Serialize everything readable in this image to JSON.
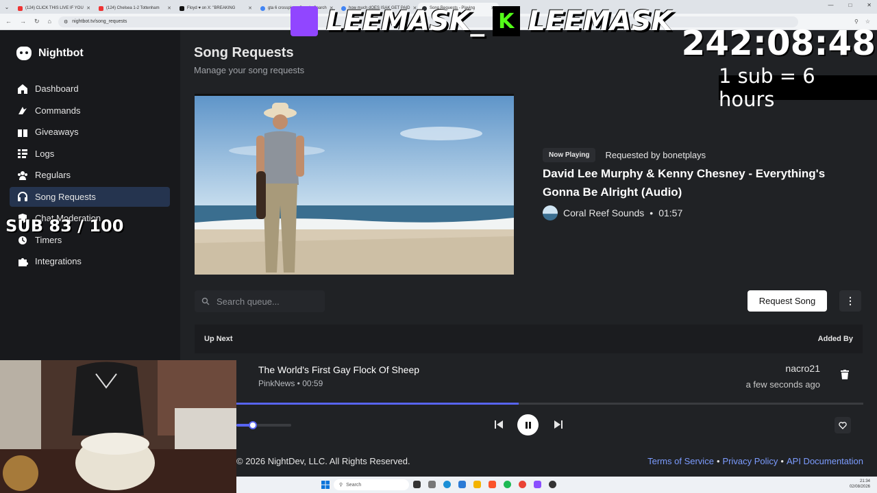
{
  "browser": {
    "tabs": [
      {
        "label": "(124) CLICK THIS LIVE IF YOU",
        "icon": "youtube-icon"
      },
      {
        "label": "(124) Chelsea 1-2 Tottenham",
        "icon": "youtube-icon"
      },
      {
        "label": "Floyd ♥ on X: \"BREAKING",
        "icon": "x-icon"
      },
      {
        "label": "gta 6 crossplay - Google Search",
        "icon": "google-icon"
      },
      {
        "label": "how much dOES ISAK GET PAID",
        "icon": "google-icon"
      },
      {
        "label": "Song Requests - Playing",
        "icon": "nightbot-icon"
      }
    ],
    "url": "nightbot.tv/song_requests"
  },
  "sidebar": {
    "brand": "Nightbot",
    "items": [
      {
        "label": "Dashboard",
        "icon": "home-icon"
      },
      {
        "label": "Commands",
        "icon": "commands-icon"
      },
      {
        "label": "Giveaways",
        "icon": "giveaways-icon"
      },
      {
        "label": "Logs",
        "icon": "logs-icon"
      },
      {
        "label": "Regulars",
        "icon": "regulars-icon"
      },
      {
        "label": "Song Requests",
        "icon": "headphones-icon"
      },
      {
        "label": "Chat Moderation",
        "icon": "shield-icon"
      },
      {
        "label": "Timers",
        "icon": "clock-icon"
      },
      {
        "label": "Integrations",
        "icon": "puzzle-icon"
      }
    ]
  },
  "page": {
    "title": "Song Requests",
    "subtitle": "Manage your song requests"
  },
  "now_playing": {
    "badge": "Now Playing",
    "requested_by": "Requested by bonetplays",
    "title": "David Lee Murphy & Kenny Chesney - Everything's Gonna Be Alright (Audio)",
    "channel": "Coral Reef Sounds",
    "separator": "•",
    "duration": "01:57"
  },
  "toolbar": {
    "search_placeholder": "Search queue...",
    "request_button": "Request Song"
  },
  "queue": {
    "header_left": "Up Next",
    "header_right": "Added By",
    "items": [
      {
        "title": "The World's First Gay Flock Of Sheep",
        "meta": "PinkNews • 00:59",
        "added_by": "nacro21",
        "added_time": "a few seconds ago"
      }
    ]
  },
  "player": {
    "progress": 0.45,
    "volume": 0.3
  },
  "footer": {
    "copyright": "© 2026 NightDev, LLC. All Rights Reserved.",
    "links": [
      "Terms of Service",
      "Privacy Policy",
      "API Documentation"
    ],
    "link_sep": "•"
  },
  "taskbar": {
    "search": "Search",
    "time": "21:34",
    "date": "02/08/2026"
  },
  "overlay": {
    "name_left": "LEEMASK_",
    "name_right": "LEEMASK",
    "kick_letter": "K",
    "timer": "242:08:48",
    "sub_rate": "1 sub = 6 hours",
    "sub_goal": "SUB 83 / 100"
  },
  "colors": {
    "accent": "#5865f2",
    "sidebar_active": "#25344f",
    "link": "#7c9cff"
  }
}
